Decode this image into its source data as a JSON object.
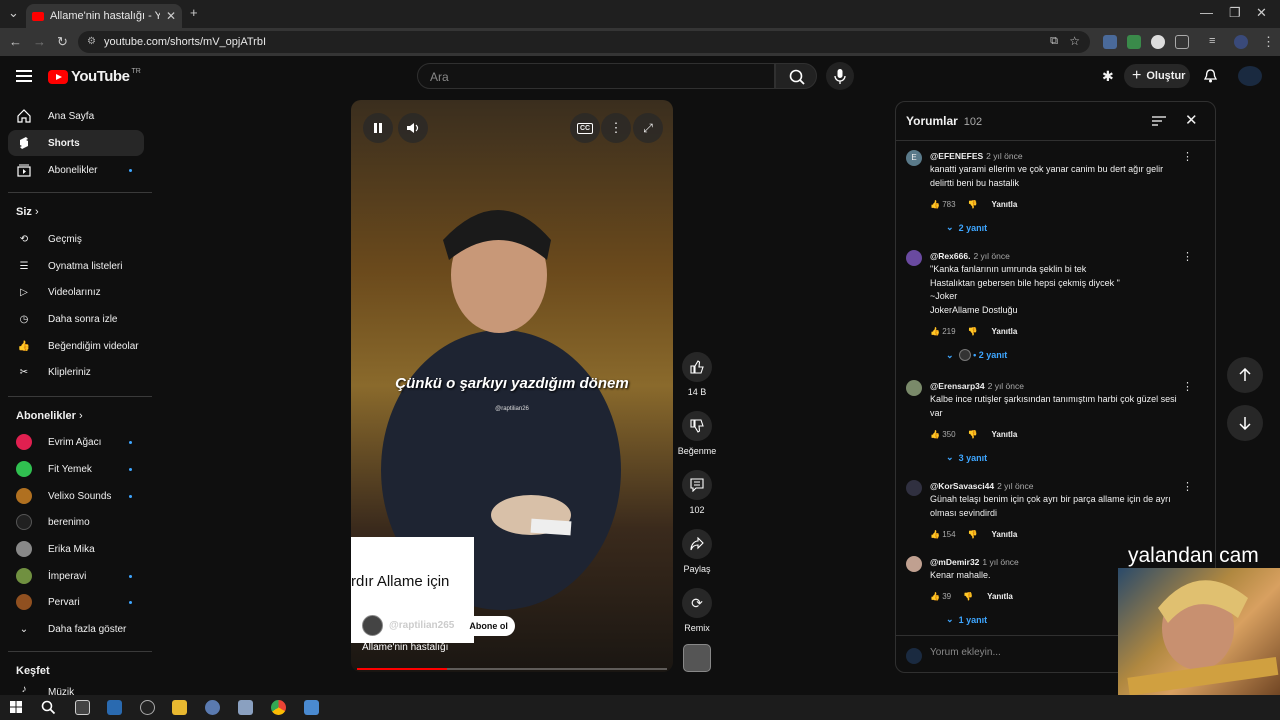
{
  "browser": {
    "tab_title": "Allame'nin hastalığı - YouTube",
    "new_tab": "+",
    "url": "youtube.com/shorts/mV_opjATrbI"
  },
  "header": {
    "logo_text": "YouTube",
    "country_code": "TR",
    "search_placeholder": "Ara",
    "create_label": "Oluştur"
  },
  "sidebar": {
    "main": [
      {
        "label": "Ana Sayfa",
        "icon": "home-icon"
      },
      {
        "label": "Shorts",
        "icon": "shorts-icon"
      },
      {
        "label": "Abonelikler",
        "icon": "subscriptions-icon"
      }
    ],
    "you_header": "Siz",
    "you": [
      {
        "label": "Geçmiş",
        "icon": "history-icon"
      },
      {
        "label": "Oynatma listeleri",
        "icon": "playlists-icon"
      },
      {
        "label": "Videolarınız",
        "icon": "your-videos-icon"
      },
      {
        "label": "Daha sonra izle",
        "icon": "watch-later-icon"
      },
      {
        "label": "Beğendiğim videolar",
        "icon": "liked-videos-icon"
      },
      {
        "label": "Klipleriniz",
        "icon": "clips-icon"
      }
    ],
    "subs_header": "Abonelikler",
    "subs": [
      {
        "label": "Evrim Ağacı",
        "color": "#e02050"
      },
      {
        "label": "Fit Yemek",
        "color": "#30c050"
      },
      {
        "label": "Velixo Sounds",
        "color": "#b07020"
      },
      {
        "label": "berenimo",
        "color": "#202020"
      },
      {
        "label": "Erika Mika",
        "color": "#888888"
      },
      {
        "label": "İmperavi",
        "color": "#709040"
      },
      {
        "label": "Pervari",
        "color": "#905020"
      }
    ],
    "show_more": "Daha fazla göster",
    "explore_header": "Keşfet",
    "explore_partial": "Müzik"
  },
  "video": {
    "caption": "Çünkü o şarkıyı yazdığım dönem",
    "watermark": "@raptilian26",
    "overlay_card_text": "rdır Allame için",
    "channel_handle": "@raptilian265",
    "subscribe_label": "Abone ol",
    "title": "Allame'nin hastalığı",
    "progress": 0.29
  },
  "actions": {
    "likes": "14 B",
    "dislike_label": "Beğenme",
    "comments": "102",
    "share_label": "Paylaş",
    "remix_label": "Remix"
  },
  "comments": {
    "title": "Yorumlar",
    "count": "102",
    "add_placeholder": "Yorum ekleyin...",
    "reply_label": "Yanıtla",
    "items": [
      {
        "author": "@EFENEFES",
        "time": "2 yıl önce",
        "text": "kanatti yarami ellerim ve çok yanar canim bu dert ağır gelir\ndelirtti beni bu hastalik",
        "likes": "783",
        "replies": "2 yanıt",
        "avatar_color": "#5a7a8a"
      },
      {
        "author": "@Rex666.",
        "time": "2 yıl önce",
        "text": "\"Kanka fanlarının umrunda şeklin bi tek\nHastalıktan gebersen bile hepsi çekmiş diycek \"\n~Joker\nJokerAllame Dostluğu",
        "likes": "219",
        "replies": "2 yanıt",
        "avatar_color": "#6a4aa0"
      },
      {
        "author": "@Erensarp34",
        "time": "2 yıl önce",
        "text": "Kalbe ince rutişler şarkısından tanımıştım harbi çok güzel sesi\nvar",
        "likes": "350",
        "replies": "3 yanıt",
        "avatar_color": "#7a8a6a"
      },
      {
        "author": "@KorSavasci44",
        "time": "2 yıl önce",
        "text": "Günah telaşı benim için çok ayrı bir parça allame için de ayrı\nolması sevindirdi",
        "likes": "154",
        "replies": "",
        "avatar_color": "#303040"
      },
      {
        "author": "@mDemir32",
        "time": "1 yıl önce",
        "text": "Kenar mahalle.",
        "likes": "39",
        "replies": "1 yanıt",
        "avatar_color": "#c0a090"
      }
    ]
  },
  "overlay": {
    "text": "yalandan cam"
  }
}
